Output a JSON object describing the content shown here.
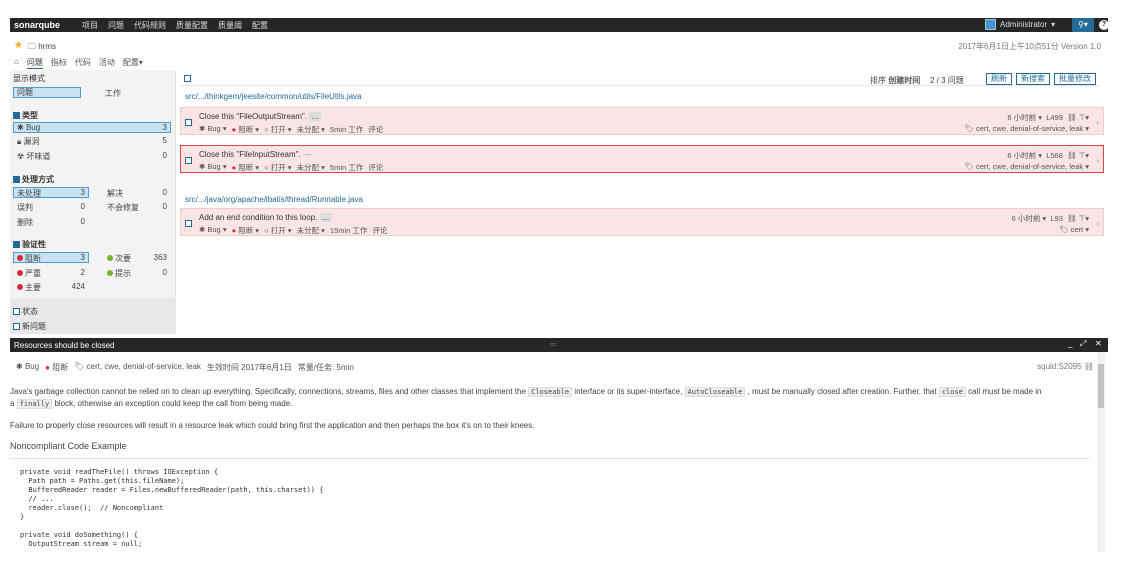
{
  "topbar": {
    "logo": "sonarqube",
    "nav": [
      "项目",
      "问题",
      "代码规则",
      "质量配置",
      "质量阈",
      "配置"
    ],
    "user": "Administrator",
    "search_icon": "search-icon",
    "help": "?"
  },
  "project": {
    "name": "hrms",
    "date_version": "2017年6月1日上午10点51分  Version 1.0",
    "tabs": [
      "问题",
      "指标",
      "代码",
      "活动",
      "配置"
    ]
  },
  "facets": {
    "display_mode_title": "显示模式",
    "mode_selected": "问题",
    "mode_other": "工作",
    "type_title": "类型",
    "types": [
      {
        "label": "Bug",
        "count": "3"
      },
      {
        "label": "漏洞",
        "count": "5"
      },
      {
        "label": "坏味道",
        "count": "0"
      }
    ],
    "resolution_title": "处理方式",
    "resolutions": [
      {
        "label": "未处理",
        "count": "3"
      },
      {
        "label": "解决",
        "count": "0"
      },
      {
        "label": "误判",
        "count": "0"
      },
      {
        "label": "不会修复",
        "count": "0"
      },
      {
        "label": "删除",
        "count": "0"
      }
    ],
    "severity_title": "验证性",
    "severities": [
      {
        "label": "阻断",
        "count": "3",
        "color": "#d02f3a"
      },
      {
        "label": "次要",
        "count": "363",
        "color": "#7bb02a"
      },
      {
        "label": "严重",
        "count": "2",
        "color": "#d02f3a"
      },
      {
        "label": "提示",
        "count": "0",
        "color": "#7bb02a"
      },
      {
        "label": "主要",
        "count": "424",
        "color": "#d02f3a"
      }
    ],
    "status_title": "状态",
    "new_issues_title": "新问题"
  },
  "list": {
    "sort_label": "排序",
    "sort_value": "创建时间",
    "counter": "2 / 3 问题",
    "refresh": "刷新",
    "new_search": "新搜索",
    "bulk_change": "批量修改",
    "path1": "src/.../thinkgem/jeesite/common/utils/FileUtils.java",
    "path2": "src/.../java/org/apache/ibatis/thread/Runnable.java",
    "issues": [
      {
        "message": "Close this \"FileOutputStream\".",
        "type": "Bug",
        "severity": "阻断",
        "status": "打开",
        "assignee": "未分配",
        "effort": "5min 工作",
        "comment": "评论",
        "age": "6 小时前",
        "line": "L499",
        "tags": "cert, cwe, denial-of-service, leak"
      },
      {
        "message": "Close this \"FileInputStream\".",
        "type": "Bug",
        "severity": "阻断",
        "status": "打开",
        "assignee": "未分配",
        "effort": "5min 工作",
        "comment": "评论",
        "age": "6 小时前",
        "line": "L568",
        "tags": "cert, cwe, denial-of-service, leak"
      },
      {
        "message": "Add an end condition to this loop.",
        "type": "Bug",
        "severity": "阻断",
        "status": "打开",
        "assignee": "未分配",
        "effort": "15min 工作",
        "comment": "评论",
        "age": "6 小时前",
        "line": "L93",
        "tags": "cert"
      }
    ]
  },
  "rule": {
    "title": "Resources should be closed",
    "type": "Bug",
    "severity": "阻断",
    "tags": "cert, cwe, denial-of-service, leak",
    "effective": "生效时间 2017年6月1日",
    "remediation": "常量/任务: 5min",
    "key": "squid:S2095",
    "p1a": "Java's garbage collection cannot be relied on to clean up everything. Specifically, connections, streams, files and other classes that implement the",
    "p1_code1": "Closeable",
    "p1b": "interface or its super-interface,",
    "p1_code2": "AutoCloseable",
    "p1c": ", must be manually closed after creation. Further, that",
    "p1_code3": "close",
    "p1d": "call must be made in",
    "p1e": "a",
    "p1_code4": "finally",
    "p1f": "block, otherwise an exception could keep the call from being made.",
    "p2": "Failure to properly close resources will result in a resource leak which could bring first the application and then perhaps the box it's on to their knees.",
    "h_noncompliant": "Noncompliant Code Example",
    "code": "private void readTheFile() throws IOException {\n  Path path = Paths.get(this.fileName);\n  BufferedReader reader = Files.newBufferedReader(path, this.charset)) {\n  // ...\n  reader.close();  // Noncompliant\n}\n\nprivate void doSomething() {\n  OutputStream stream = null;"
  }
}
